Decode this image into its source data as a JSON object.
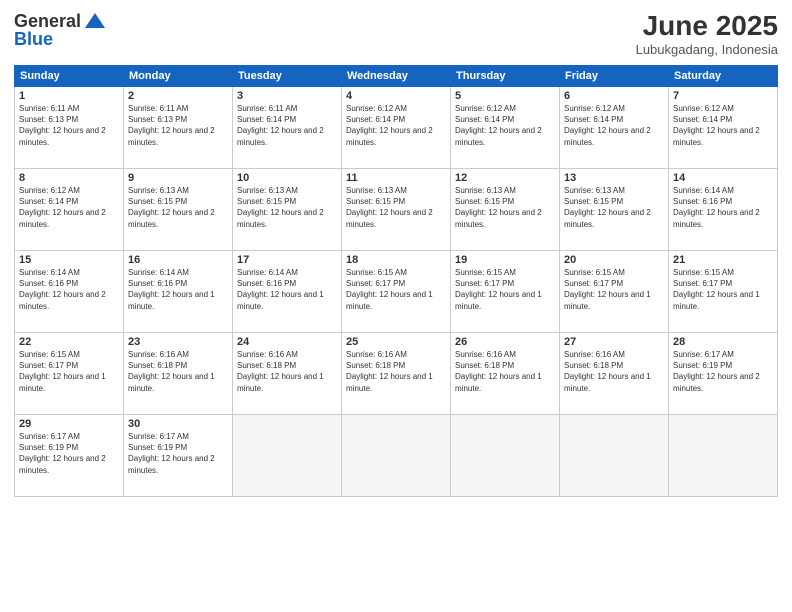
{
  "logo": {
    "general": "General",
    "blue": "Blue"
  },
  "title": {
    "month": "June 2025",
    "location": "Lubukgadang, Indonesia"
  },
  "headers": [
    "Sunday",
    "Monday",
    "Tuesday",
    "Wednesday",
    "Thursday",
    "Friday",
    "Saturday"
  ],
  "weeks": [
    [
      {
        "day": "1",
        "sunrise": "6:11 AM",
        "sunset": "6:13 PM",
        "daylight": "12 hours and 2 minutes."
      },
      {
        "day": "2",
        "sunrise": "6:11 AM",
        "sunset": "6:13 PM",
        "daylight": "12 hours and 2 minutes."
      },
      {
        "day": "3",
        "sunrise": "6:11 AM",
        "sunset": "6:14 PM",
        "daylight": "12 hours and 2 minutes."
      },
      {
        "day": "4",
        "sunrise": "6:12 AM",
        "sunset": "6:14 PM",
        "daylight": "12 hours and 2 minutes."
      },
      {
        "day": "5",
        "sunrise": "6:12 AM",
        "sunset": "6:14 PM",
        "daylight": "12 hours and 2 minutes."
      },
      {
        "day": "6",
        "sunrise": "6:12 AM",
        "sunset": "6:14 PM",
        "daylight": "12 hours and 2 minutes."
      },
      {
        "day": "7",
        "sunrise": "6:12 AM",
        "sunset": "6:14 PM",
        "daylight": "12 hours and 2 minutes."
      }
    ],
    [
      {
        "day": "8",
        "sunrise": "6:12 AM",
        "sunset": "6:14 PM",
        "daylight": "12 hours and 2 minutes."
      },
      {
        "day": "9",
        "sunrise": "6:13 AM",
        "sunset": "6:15 PM",
        "daylight": "12 hours and 2 minutes."
      },
      {
        "day": "10",
        "sunrise": "6:13 AM",
        "sunset": "6:15 PM",
        "daylight": "12 hours and 2 minutes."
      },
      {
        "day": "11",
        "sunrise": "6:13 AM",
        "sunset": "6:15 PM",
        "daylight": "12 hours and 2 minutes."
      },
      {
        "day": "12",
        "sunrise": "6:13 AM",
        "sunset": "6:15 PM",
        "daylight": "12 hours and 2 minutes."
      },
      {
        "day": "13",
        "sunrise": "6:13 AM",
        "sunset": "6:15 PM",
        "daylight": "12 hours and 2 minutes."
      },
      {
        "day": "14",
        "sunrise": "6:14 AM",
        "sunset": "6:16 PM",
        "daylight": "12 hours and 2 minutes."
      }
    ],
    [
      {
        "day": "15",
        "sunrise": "6:14 AM",
        "sunset": "6:16 PM",
        "daylight": "12 hours and 2 minutes."
      },
      {
        "day": "16",
        "sunrise": "6:14 AM",
        "sunset": "6:16 PM",
        "daylight": "12 hours and 1 minute."
      },
      {
        "day": "17",
        "sunrise": "6:14 AM",
        "sunset": "6:16 PM",
        "daylight": "12 hours and 1 minute."
      },
      {
        "day": "18",
        "sunrise": "6:15 AM",
        "sunset": "6:17 PM",
        "daylight": "12 hours and 1 minute."
      },
      {
        "day": "19",
        "sunrise": "6:15 AM",
        "sunset": "6:17 PM",
        "daylight": "12 hours and 1 minute."
      },
      {
        "day": "20",
        "sunrise": "6:15 AM",
        "sunset": "6:17 PM",
        "daylight": "12 hours and 1 minute."
      },
      {
        "day": "21",
        "sunrise": "6:15 AM",
        "sunset": "6:17 PM",
        "daylight": "12 hours and 1 minute."
      }
    ],
    [
      {
        "day": "22",
        "sunrise": "6:15 AM",
        "sunset": "6:17 PM",
        "daylight": "12 hours and 1 minute."
      },
      {
        "day": "23",
        "sunrise": "6:16 AM",
        "sunset": "6:18 PM",
        "daylight": "12 hours and 1 minute."
      },
      {
        "day": "24",
        "sunrise": "6:16 AM",
        "sunset": "6:18 PM",
        "daylight": "12 hours and 1 minute."
      },
      {
        "day": "25",
        "sunrise": "6:16 AM",
        "sunset": "6:18 PM",
        "daylight": "12 hours and 1 minute."
      },
      {
        "day": "26",
        "sunrise": "6:16 AM",
        "sunset": "6:18 PM",
        "daylight": "12 hours and 1 minute."
      },
      {
        "day": "27",
        "sunrise": "6:16 AM",
        "sunset": "6:18 PM",
        "daylight": "12 hours and 1 minute."
      },
      {
        "day": "28",
        "sunrise": "6:17 AM",
        "sunset": "6:19 PM",
        "daylight": "12 hours and 2 minutes."
      }
    ],
    [
      {
        "day": "29",
        "sunrise": "6:17 AM",
        "sunset": "6:19 PM",
        "daylight": "12 hours and 2 minutes."
      },
      {
        "day": "30",
        "sunrise": "6:17 AM",
        "sunset": "6:19 PM",
        "daylight": "12 hours and 2 minutes."
      },
      null,
      null,
      null,
      null,
      null
    ]
  ]
}
